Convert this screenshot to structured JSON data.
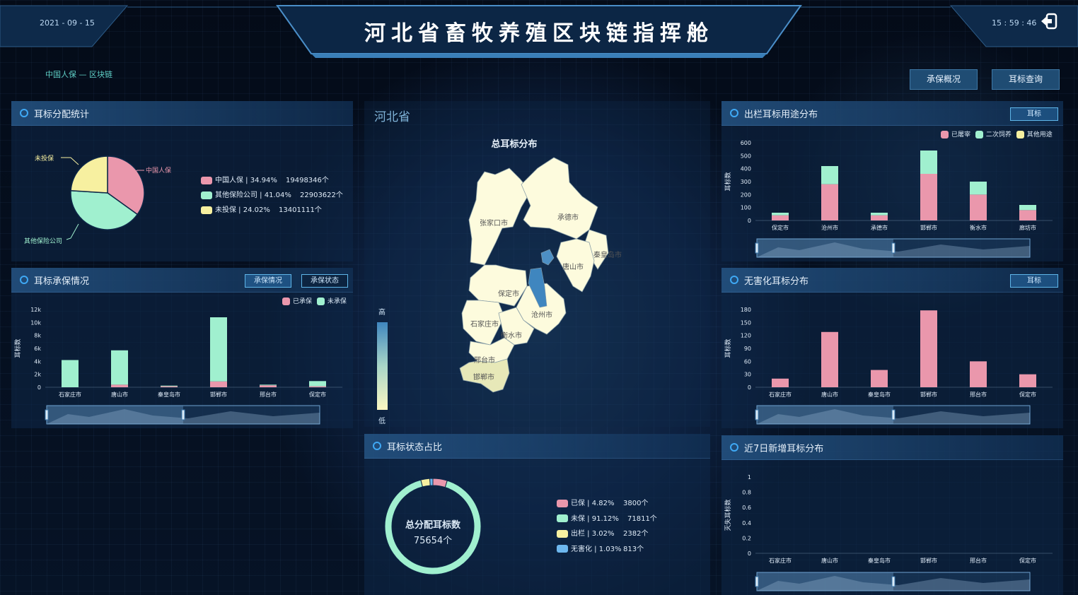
{
  "header": {
    "title": "河北省畜牧养殖区块链指挥舱",
    "date": "2021 - 09 - 15",
    "time": "15 : 59 : 46",
    "breadcrumb": "中国人保 — 区块链"
  },
  "nav": {
    "btn1": "承保概况",
    "btn2": "耳标查询"
  },
  "colors": {
    "pink": "#ea97ac",
    "green": "#a0f0cf",
    "yellow": "#f7f0a0",
    "blue": "#6db7ee"
  },
  "p1": {
    "title": "耳标分配统计",
    "labels": {
      "a": "中国人保",
      "b": "其他保险公司",
      "c": "未投保"
    },
    "legend": [
      {
        "name": "中国人保",
        "pct": "34.94%",
        "count": "19498346个"
      },
      {
        "name": "其他保险公司",
        "pct": "41.04%",
        "count": "22903622个"
      },
      {
        "name": "未投保",
        "pct": "24.02%",
        "count": "13401111个"
      }
    ],
    "chart_data": {
      "type": "pie",
      "values": [
        34.94,
        41.04,
        24.02
      ],
      "categories": [
        "中国人保",
        "其他保险公司",
        "未投保"
      ]
    }
  },
  "p2": {
    "title": "耳标承保情况",
    "btn1": "承保情况",
    "btn2": "承保状态",
    "ylabel": "耳标数",
    "legend": [
      "已承保",
      "未承保"
    ],
    "chart_data": {
      "type": "bar",
      "categories": [
        "石家庄市",
        "唐山市",
        "秦皇岛市",
        "邯郸市",
        "邢台市",
        "保定市"
      ],
      "yticks": [
        "0",
        "2k",
        "4k",
        "6k",
        "8k",
        "10k",
        "12k"
      ],
      "ylim": [
        0,
        12000
      ],
      "series": [
        {
          "name": "已承保",
          "values": [
            0,
            400,
            150,
            900,
            300,
            150
          ]
        },
        {
          "name": "未承保",
          "values": [
            4200,
            5300,
            100,
            9900,
            100,
            800
          ]
        }
      ]
    }
  },
  "map": {
    "province": "河北省",
    "title": "总耳标分布",
    "high": "高",
    "low": "低",
    "cities": [
      "张家口市",
      "承德市",
      "秦皇岛市",
      "唐山市",
      "保定市",
      "沧州市",
      "石家庄市",
      "衡水市",
      "邢台市",
      "邯郸市"
    ]
  },
  "p3": {
    "title": "出栏耳标用途分布",
    "btn": "耳标",
    "ylabel": "耳标数",
    "legend": [
      "已屠宰",
      "二次饲养",
      "其他用途"
    ],
    "chart_data": {
      "type": "bar",
      "categories": [
        "保定市",
        "沧州市",
        "承德市",
        "邯郸市",
        "衡水市",
        "廊坊市"
      ],
      "yticks": [
        "0",
        "100",
        "200",
        "300",
        "400",
        "500",
        "600"
      ],
      "ylim": [
        0,
        600
      ],
      "series": [
        {
          "name": "已屠宰",
          "values": [
            40,
            280,
            40,
            360,
            200,
            80
          ]
        },
        {
          "name": "二次饲养",
          "values": [
            20,
            140,
            20,
            180,
            100,
            40
          ]
        },
        {
          "name": "其他用途",
          "values": [
            0,
            0,
            0,
            0,
            0,
            0
          ]
        }
      ]
    }
  },
  "p4": {
    "title": "无害化耳标分布",
    "btn": "耳标",
    "ylabel": "耳标数",
    "chart_data": {
      "type": "bar",
      "categories": [
        "石家庄市",
        "唐山市",
        "秦皇岛市",
        "邯郸市",
        "邢台市",
        "保定市"
      ],
      "yticks": [
        "0",
        "30",
        "60",
        "90",
        "120",
        "150",
        "180"
      ],
      "ylim": [
        0,
        180
      ],
      "values": [
        20,
        128,
        40,
        178,
        60,
        30
      ]
    }
  },
  "p5": {
    "title": "耳标状态占比",
    "center_title": "总分配耳标数",
    "center_value": "75654个",
    "legend": [
      {
        "name": "已保",
        "pct": "4.82%",
        "count": "3800个"
      },
      {
        "name": "未保",
        "pct": "91.12%",
        "count": "71811个"
      },
      {
        "name": "出栏",
        "pct": "3.02%",
        "count": "2382个"
      },
      {
        "name": "无害化",
        "pct": "1.03%",
        "count": "813个"
      }
    ],
    "chart_data": {
      "type": "pie",
      "values": [
        4.82,
        91.12,
        3.02,
        1.03
      ],
      "categories": [
        "已保",
        "未保",
        "出栏",
        "无害化"
      ]
    }
  },
  "p6": {
    "title": "近7日新增耳标分布",
    "ylabel": "灭失耳标数",
    "chart_data": {
      "type": "bar",
      "categories": [
        "石家庄市",
        "唐山市",
        "秦皇岛市",
        "邯郸市",
        "邢台市",
        "保定市"
      ],
      "yticks": [
        "0",
        "0.2",
        "0.4",
        "0.6",
        "0.8",
        "1"
      ],
      "ylim": [
        0,
        1
      ],
      "values": [
        0,
        0,
        0,
        0,
        0,
        0
      ]
    }
  }
}
